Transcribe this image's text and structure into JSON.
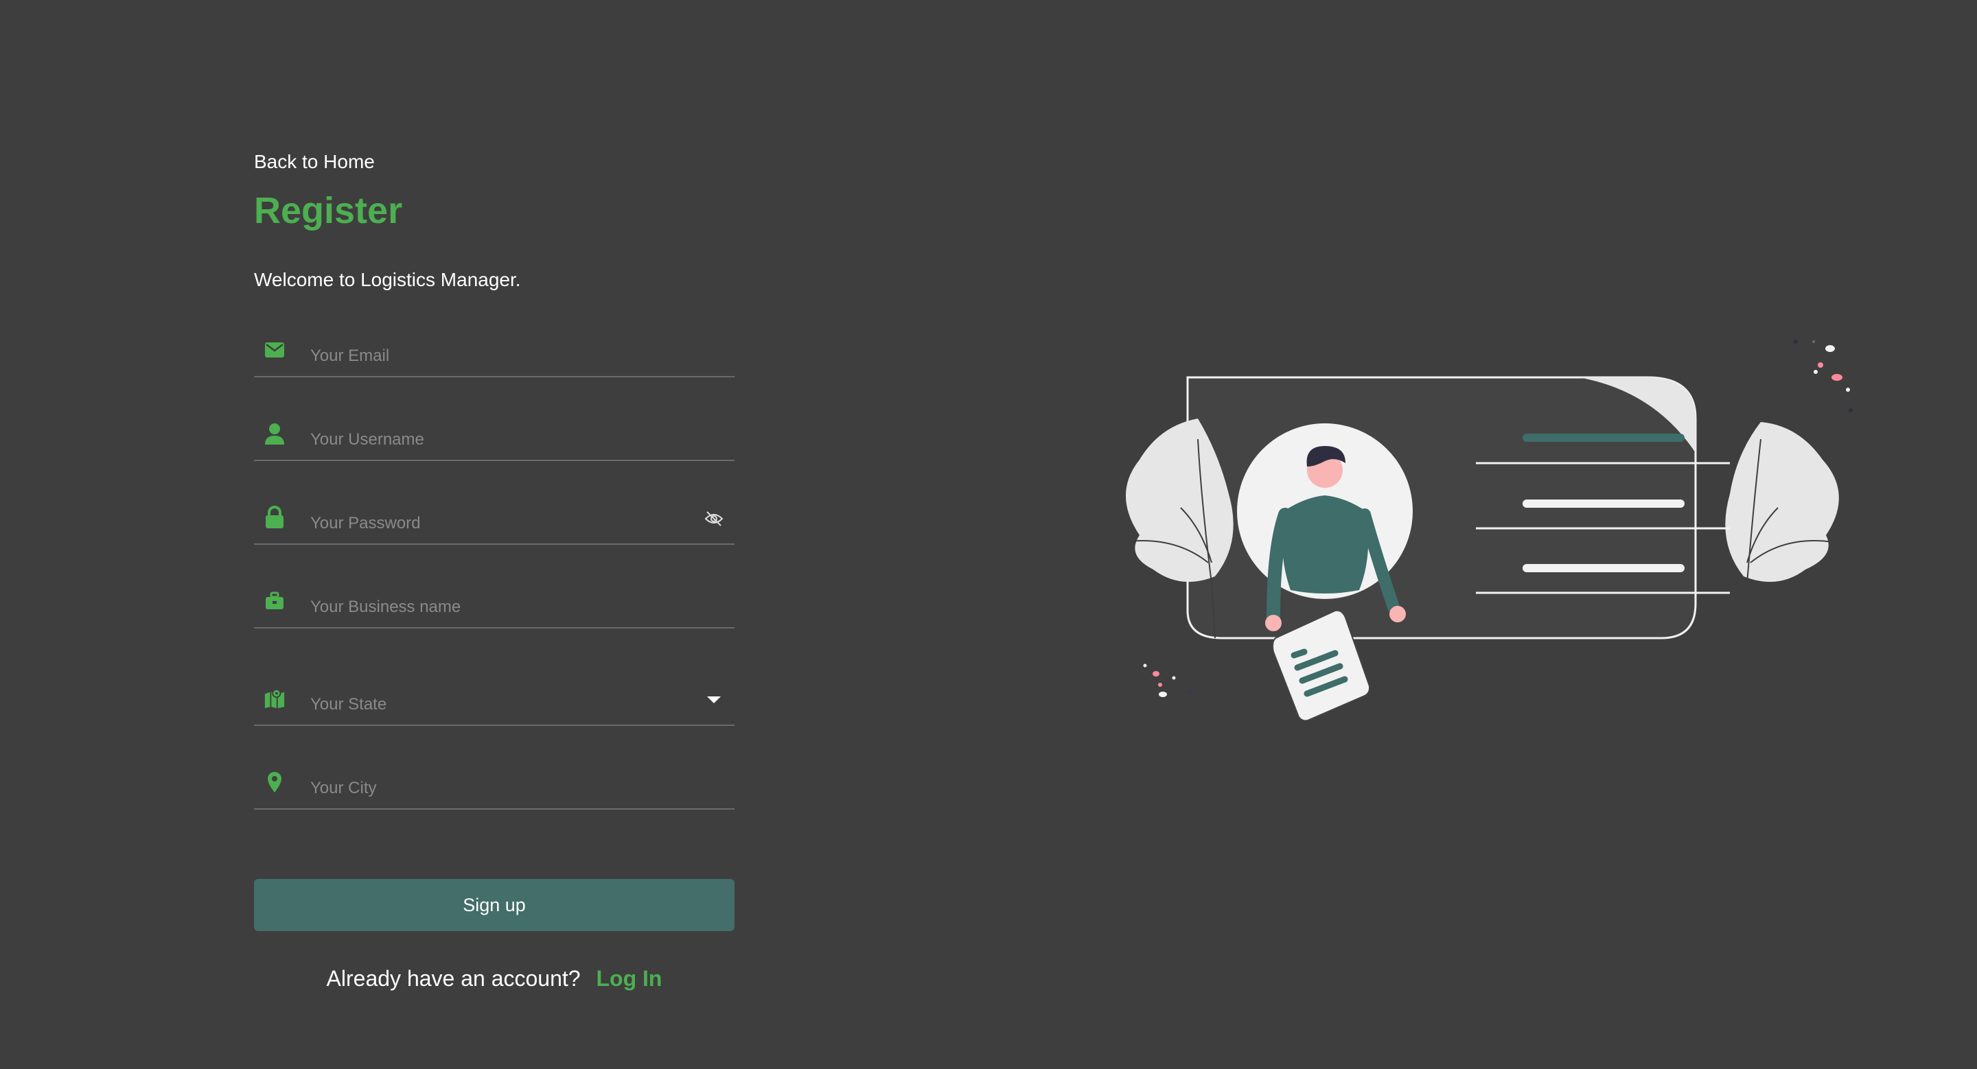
{
  "nav": {
    "back_label": "Back to Home"
  },
  "header": {
    "title": "Register",
    "welcome": "Welcome to Logistics Manager."
  },
  "form": {
    "email": {
      "placeholder": "Your Email",
      "icon": "envelope-icon"
    },
    "username": {
      "placeholder": "Your Username",
      "icon": "person-icon"
    },
    "password": {
      "placeholder": "Your Password",
      "icon": "lock-icon",
      "toggle_icon": "eye-off-icon"
    },
    "business": {
      "placeholder": "Your Business name",
      "icon": "briefcase-icon"
    },
    "state": {
      "placeholder": "Your State",
      "icon": "map-icon",
      "dropdown_icon": "caret-down-icon"
    },
    "city": {
      "placeholder": "Your City",
      "icon": "location-pin-icon"
    }
  },
  "actions": {
    "signup_label": "Sign up",
    "login_prompt": "Already have an account?",
    "login_label": "Log In"
  },
  "colors": {
    "background": "#3e3e3e",
    "accent_green": "#4caf50",
    "button_teal": "#436e6a",
    "figure_teal": "#3f6d69",
    "light_gray": "#e6e6e6",
    "pink": "#f98a9b"
  }
}
